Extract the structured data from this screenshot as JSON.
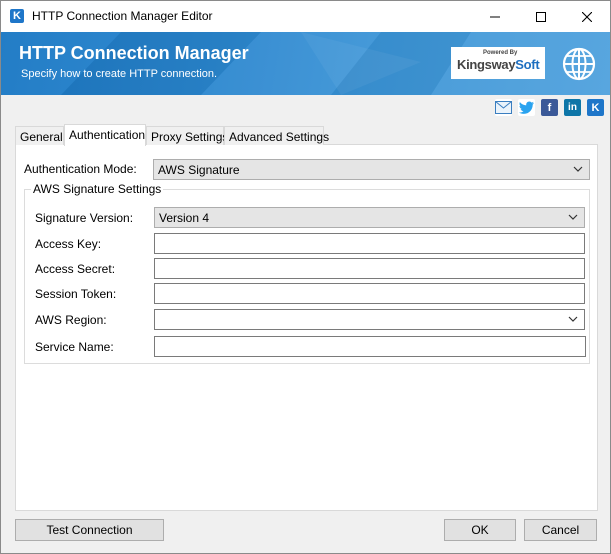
{
  "window": {
    "title": "HTTP Connection Manager Editor",
    "app_icon_letter": "K"
  },
  "banner": {
    "title": "HTTP Connection Manager",
    "subtitle": "Specify how to create HTTP connection.",
    "brand_powered": "Powered By",
    "brand_name_a": "Kingsway",
    "brand_name_b": "Soft"
  },
  "social": {
    "items": [
      "email-icon",
      "twitter-icon",
      "facebook-icon",
      "linkedin-icon",
      "kingswaysoft-icon"
    ],
    "facebook_glyph": "f",
    "linkedin_glyph": "in",
    "kingsway_glyph": "K"
  },
  "tabs": [
    {
      "label": "General"
    },
    {
      "label": "Authentication"
    },
    {
      "label": "Proxy Settings"
    },
    {
      "label": "Advanced Settings"
    }
  ],
  "auth": {
    "mode_label": "Authentication Mode:",
    "mode_value": "AWS Signature",
    "group_title": "AWS Signature Settings",
    "signature_version_label": "Signature Version:",
    "signature_version_value": "Version 4",
    "access_key_label": "Access Key:",
    "access_key_value": "",
    "access_secret_label": "Access Secret:",
    "access_secret_value": "",
    "session_token_label": "Session Token:",
    "session_token_value": "",
    "aws_region_label": "AWS Region:",
    "aws_region_value": "",
    "service_name_label": "Service Name:",
    "service_name_value": ""
  },
  "buttons": {
    "test_connection": "Test Connection",
    "ok": "OK",
    "cancel": "Cancel"
  },
  "colors": {
    "banner_blue": "#1b78c4",
    "brand_blue": "#1e6fc0"
  }
}
